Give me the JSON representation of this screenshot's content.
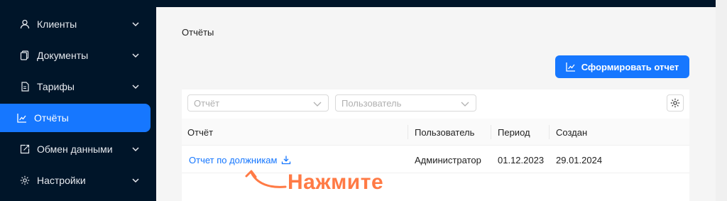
{
  "sidebar": {
    "items": [
      {
        "label": "Клиенты",
        "icon": "user-icon",
        "active": false
      },
      {
        "label": "Документы",
        "icon": "documents-icon",
        "active": false
      },
      {
        "label": "Тарифы",
        "icon": "tariff-icon",
        "active": false
      },
      {
        "label": "Отчёты",
        "icon": "chart-icon",
        "active": true
      },
      {
        "label": "Обмен данными",
        "icon": "exchange-icon",
        "active": false
      },
      {
        "label": "Настройки",
        "icon": "gear-icon",
        "active": false
      }
    ]
  },
  "page": {
    "title": "Отчёты"
  },
  "toolbar": {
    "generate_label": "Сформировать отчет"
  },
  "filters": {
    "report_placeholder": "Отчёт",
    "user_placeholder": "Пользователь"
  },
  "table": {
    "columns": [
      "Отчёт",
      "Пользователь",
      "Период",
      "Создан"
    ],
    "rows": [
      {
        "report": "Отчет по должникам",
        "user": "Администратор",
        "period": "01.12.2023",
        "created": "29.01.2024"
      }
    ]
  },
  "callout": {
    "text": "Нажмите"
  },
  "colors": {
    "accent": "#1677ff",
    "sidebar": "#001529",
    "callout": "#ff7a45"
  }
}
